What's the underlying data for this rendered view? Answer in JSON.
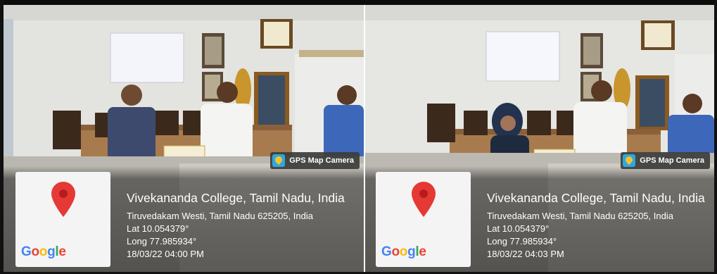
{
  "badge_label": "GPS Map Camera",
  "map_logo": "Google",
  "colors": {
    "pin": "#e53935",
    "overlay_text": "#ffffff",
    "badge_icon": "#2ea7e0"
  },
  "photos": [
    {
      "place": "Vivekananda College, Tamil Nadu, India",
      "address": "Tiruvedakam Westi, Tamil Nadu 625205, India",
      "lat": "Lat 10.054379°",
      "long": "Long 77.985934°",
      "datetime": "18/03/22 04:00 PM"
    },
    {
      "place": "Vivekananda College, Tamil Nadu, India",
      "address": "Tiruvedakam Westi, Tamil Nadu 625205, India",
      "lat": "Lat 10.054379°",
      "long": "Long 77.985934°",
      "datetime": "18/03/22 04:03 PM"
    }
  ]
}
